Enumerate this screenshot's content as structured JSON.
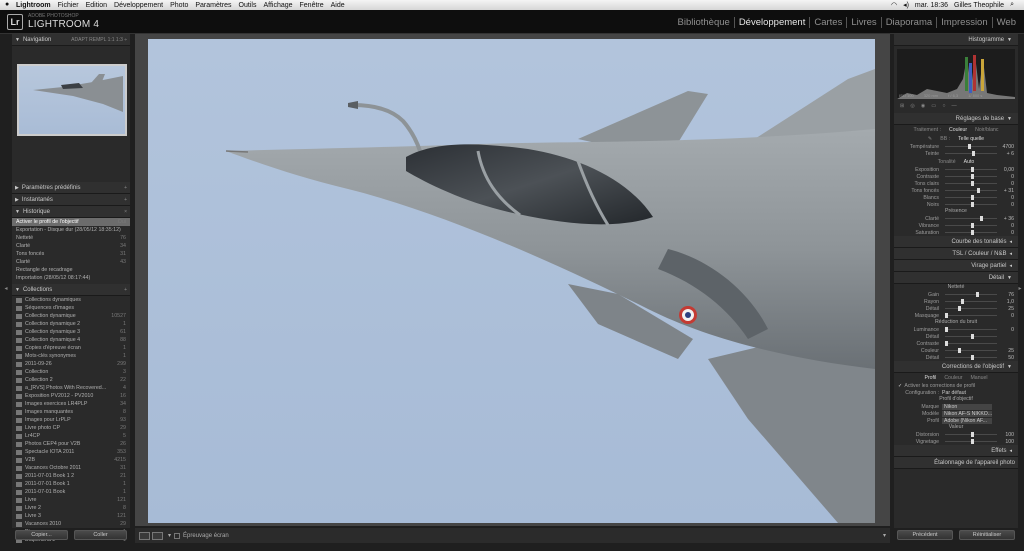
{
  "menubar": {
    "items": [
      "Lightroom",
      "Fichier",
      "Edition",
      "Développement",
      "Photo",
      "Paramètres",
      "Outils",
      "Affichage",
      "Fenêtre",
      "Aide"
    ],
    "clock": "mar. 18:36",
    "user": "Gilles Theophile"
  },
  "identity": {
    "logo": "Lr",
    "subtitle": "ADOBE PHOTOSHOP",
    "name": "LIGHTROOM 4"
  },
  "modules": [
    "Bibliothèque",
    "Développement",
    "Cartes",
    "Livres",
    "Diaporama",
    "Impression",
    "Web"
  ],
  "active_module": "Développement",
  "left": {
    "navigator": {
      "title": "Navigation",
      "opts": "ADAPT REMPL 1:1 1:3 ÷"
    },
    "presets": "Paramètres prédéfinis",
    "snapshots": "Instantanés",
    "history": {
      "title": "Historique",
      "items": [
        {
          "label": "Activer le profil de l'objectif",
          "v1": "Oui",
          "sel": true
        },
        {
          "label": "Exportation - Disque dur (28/05/12 18:35:12)",
          "v1": ""
        },
        {
          "label": "Netteté",
          "v1": "76"
        },
        {
          "label": "Clarté",
          "v1": "34"
        },
        {
          "label": "Tons foncés",
          "v1": "31"
        },
        {
          "label": "Clarté",
          "v1": "43"
        },
        {
          "label": "Rectangle de recadrage",
          "v1": ""
        },
        {
          "label": "Importation (28/05/12 08:17:44)",
          "v1": ""
        }
      ]
    },
    "collections": {
      "title": "Collections",
      "items": [
        {
          "label": "Collections dynamiques",
          "v": ""
        },
        {
          "label": "Séquences d'images",
          "v": ""
        },
        {
          "label": "Collection dynamique",
          "v": "10527"
        },
        {
          "label": "Collection dynamique 2",
          "v": "1"
        },
        {
          "label": "Collection dynamique 3",
          "v": "61"
        },
        {
          "label": "Collection dynamique 4",
          "v": "88"
        },
        {
          "label": "Copies d'épreuve écran",
          "v": "1"
        },
        {
          "label": "Mots-clés synonymes",
          "v": "1"
        },
        {
          "label": "2011-09-26",
          "v": "299"
        },
        {
          "label": "Collection",
          "v": "3"
        },
        {
          "label": "Collection 2",
          "v": "22"
        },
        {
          "label": "a_[RVS] Photos With Recovered...",
          "v": "4"
        },
        {
          "label": "Exposition PV2012 - PV2010",
          "v": "16"
        },
        {
          "label": "Images exercices LR4PLP",
          "v": "34"
        },
        {
          "label": "Images manquantes",
          "v": "8"
        },
        {
          "label": "Images pour LrPLP",
          "v": "93"
        },
        {
          "label": "Livre photo CP",
          "v": "29"
        },
        {
          "label": "Lr4CP",
          "v": "5"
        },
        {
          "label": "Photos CEP4 pour V2B",
          "v": "26"
        },
        {
          "label": "Spectacle IOTA 2011",
          "v": "353"
        },
        {
          "label": "V2B",
          "v": "4215"
        },
        {
          "label": "Vacances Octobre 2011",
          "v": "31"
        },
        {
          "label": "2011-07-01 Book 1 2",
          "v": "21"
        },
        {
          "label": "2011-07-01 Book 1",
          "v": "1"
        },
        {
          "label": "2011-07-01 Book",
          "v": "1"
        },
        {
          "label": "Livre",
          "v": "121"
        },
        {
          "label": "Livre 2",
          "v": "8"
        },
        {
          "label": "Livre 3",
          "v": "121"
        },
        {
          "label": "Vacances 2010",
          "v": "29"
        },
        {
          "label": "Diaporama",
          "v": "1"
        },
        {
          "label": "Diaporama 2",
          "v": "1"
        }
      ]
    },
    "copy_btn": "Copier...",
    "paste_btn": "Coller"
  },
  "toolbar": {
    "proof": "Épreuvage écran"
  },
  "right": {
    "histogram": {
      "title": "Histogramme",
      "info": [
        "ISO 100",
        "320 mm",
        "f / 6,3",
        "1/ 800 s"
      ]
    },
    "basic": {
      "title": "Réglages de base",
      "treatment": [
        "Traitement :",
        "Couleur",
        "Noir/blanc"
      ],
      "wb": [
        "BB :",
        "Telle quelle"
      ],
      "sliders1": [
        {
          "l": "Température",
          "v": "4700",
          "p": 0.45
        },
        {
          "l": "Teinte",
          "v": "+ 6",
          "p": 0.52
        }
      ],
      "tone": "Tonalité",
      "auto": "Auto",
      "sliders2": [
        {
          "l": "Exposition",
          "v": "0,00",
          "p": 0.5
        },
        {
          "l": "Contraste",
          "v": "0",
          "p": 0.5
        },
        {
          "l": "Tons clairs",
          "v": "0",
          "p": 0.5
        },
        {
          "l": "Tons foncés",
          "v": "+ 31",
          "p": 0.62
        },
        {
          "l": "Blancs",
          "v": "0",
          "p": 0.5
        },
        {
          "l": "Noirs",
          "v": "0",
          "p": 0.5
        }
      ],
      "presence": "Présence",
      "sliders3": [
        {
          "l": "Clarté",
          "v": "+ 36",
          "p": 0.68
        },
        {
          "l": "Vibrance",
          "v": "0",
          "p": 0.5
        },
        {
          "l": "Saturation",
          "v": "0",
          "p": 0.5
        }
      ]
    },
    "tone_curve": "Courbe des tonalités",
    "hsl": "TSL / Couleur / N&B",
    "split": "Virage partiel",
    "detail": {
      "title": "Détail",
      "sharp": "Netteté",
      "sliders": [
        {
          "l": "Gain",
          "v": "76",
          "p": 0.6
        },
        {
          "l": "Rayon",
          "v": "1,0",
          "p": 0.3
        },
        {
          "l": "Détail",
          "v": "25",
          "p": 0.25
        },
        {
          "l": "Masquage",
          "v": "0",
          "p": 0.0
        }
      ],
      "noise": "Réduction du bruit",
      "sliders2": [
        {
          "l": "Luminance",
          "v": "0",
          "p": 0.0
        },
        {
          "l": "Détail",
          "v": "",
          "p": 0.5
        },
        {
          "l": "Contraste",
          "v": "",
          "p": 0.0
        },
        {
          "l": "Couleur",
          "v": "25",
          "p": 0.25
        },
        {
          "l": "Détail",
          "v": "50",
          "p": 0.5
        }
      ]
    },
    "lens": {
      "title": "Corrections de l'objectif",
      "tabs": [
        "Profil",
        "Couleur",
        "Manuel"
      ],
      "enable": "Activer les corrections de profil",
      "config": [
        "Configuration :",
        "Par défaut"
      ],
      "profile": "Profil d'objectif",
      "make": [
        "Marque",
        "Nikon"
      ],
      "model": [
        "Modèle",
        "Nikon AF-S NIKKO..."
      ],
      "profile_sel": [
        "Profil",
        "Adobe (Nikon AF..."
      ],
      "amount": "Valeur",
      "sliders": [
        {
          "l": "Distorsion",
          "v": "100",
          "p": 0.5
        },
        {
          "l": "Vignetage",
          "v": "100",
          "p": 0.5
        }
      ]
    },
    "effects": "Effets",
    "cam_cal": "Étalonnage de l'appareil photo",
    "prev_btn": "Précédent",
    "reset_btn": "Réinitialiser"
  }
}
